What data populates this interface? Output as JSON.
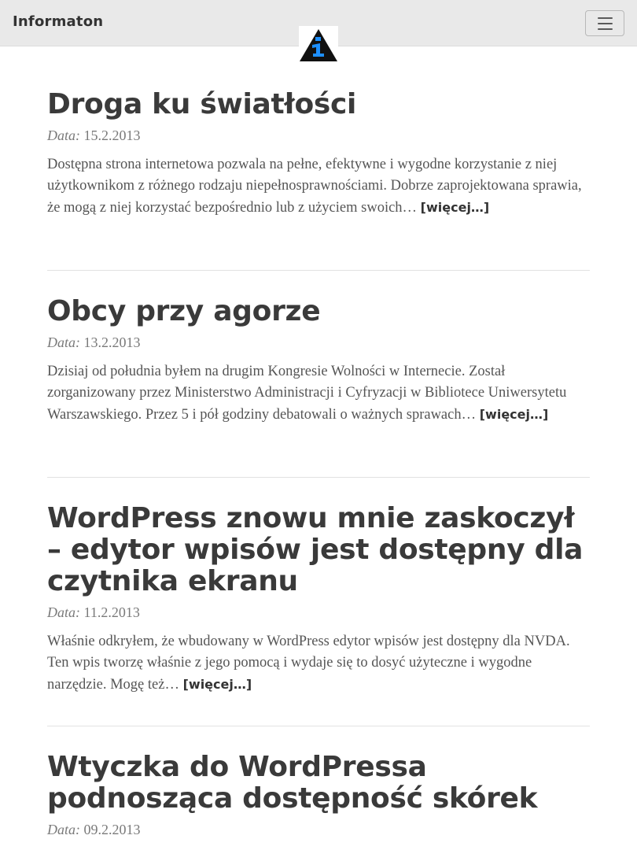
{
  "navbar": {
    "brand": "Informaton",
    "logo_icon": "info-logo-icon",
    "menu_icon": "hamburger-menu-icon"
  },
  "posts": [
    {
      "title": "Droga ku światłości",
      "date_label": "Data:",
      "date": "15.2.2013",
      "excerpt": "Dostępna strona internetowa pozwala na pełne, efektywne i wygodne korzystanie z niej użytkownikom z różnego rodzaju niepełnosprawnościami. Dobrze zaprojektowana sprawia, że mogą z niej korzystać bezpośrednio lub z użyciem swoich…",
      "more": "[więcej…]"
    },
    {
      "title": "Obcy przy agorze",
      "date_label": "Data:",
      "date": "13.2.2013",
      "excerpt": "Dzisiaj od południa byłem na drugim Kongresie Wolności w Internecie. Został zorganizowany przez Ministerstwo Administracji i Cyfryzacji w Bibliotece Uniwersytetu Warszawskiego. Przez 5 i pół godziny debatowali o ważnych sprawach…",
      "more": "[więcej…]"
    },
    {
      "title": "WordPress znowu mnie zaskoczył – edytor wpisów jest dostępny dla czytnika ekranu",
      "date_label": "Data:",
      "date": "11.2.2013",
      "excerpt": "Właśnie odkryłem, że wbudowany w WordPress edytor wpisów jest dostępny dla NVDA. Ten wpis tworzę właśnie z jego pomocą i wydaje się to dosyć użyteczne i wygodne narzędzie. Mogę też…",
      "more": "[więcej…]"
    },
    {
      "title": "Wtyczka do WordPressa podnosząca dostępność skórek",
      "date_label": "Data:",
      "date": "09.2.2013"
    }
  ],
  "colors": {
    "navbar_bg": "#e9e9e9",
    "logo_triangle": "#111111",
    "logo_glyph": "#1e90ff",
    "text": "#3a3a3a",
    "muted": "#7a7a7a"
  }
}
